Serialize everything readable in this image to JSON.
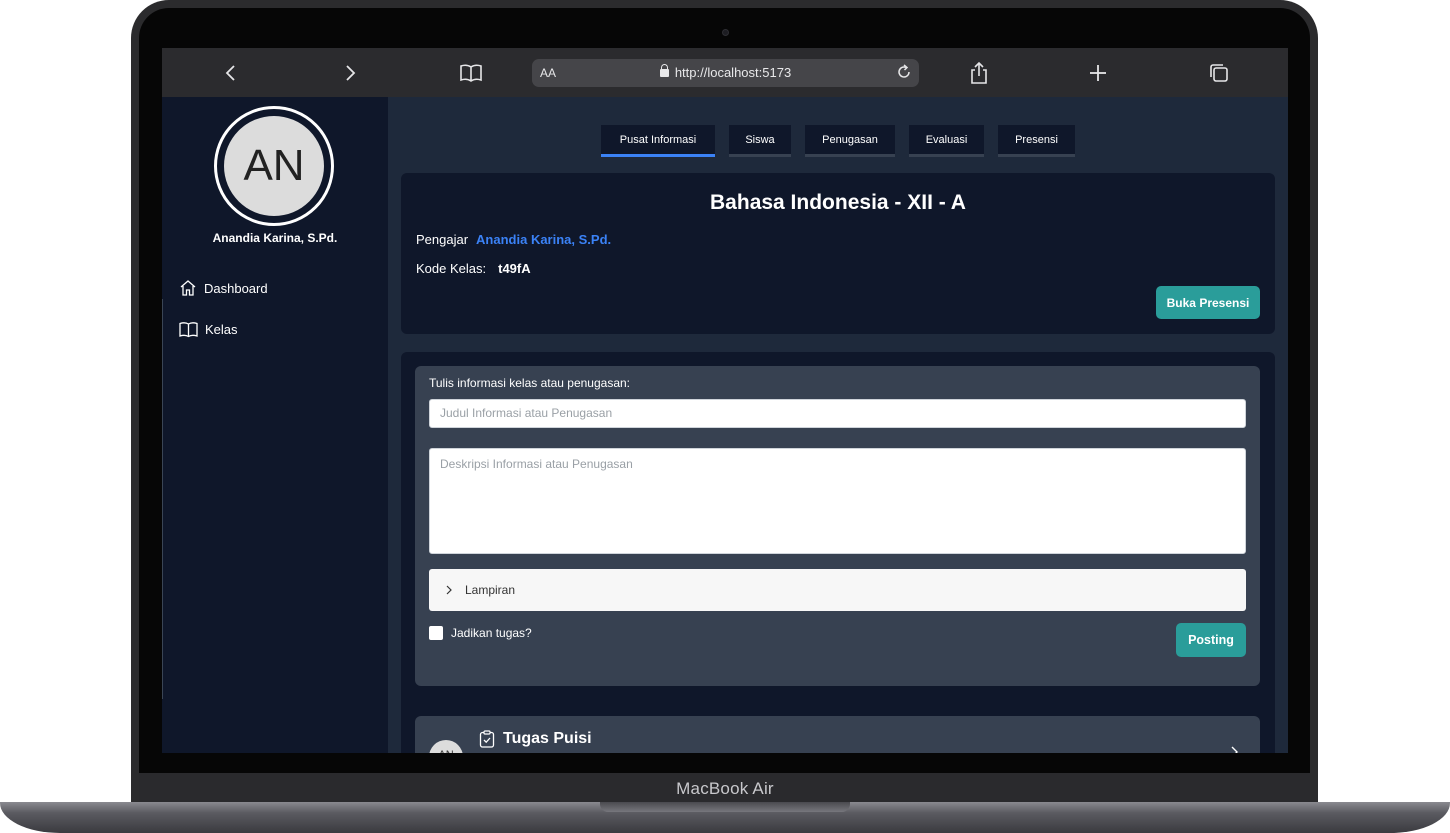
{
  "device": {
    "label": "MacBook Air"
  },
  "browser": {
    "aa_label": "AA",
    "url": "http://localhost:5173",
    "icons": [
      "chevron-left-icon",
      "chevron-right-icon",
      "book-icon",
      "lock-icon",
      "reload-icon",
      "share-icon",
      "plus-icon",
      "tabs-icon"
    ]
  },
  "sidebar": {
    "avatar_initials": "AN",
    "user_name": "Anandia Karina, S.Pd.",
    "items": [
      {
        "label": "Dashboard",
        "icon": "home-icon"
      },
      {
        "label": "Kelas",
        "icon": "book-icon"
      }
    ]
  },
  "tabs": [
    {
      "label": "Pusat Informasi",
      "active": true
    },
    {
      "label": "Siswa",
      "active": false
    },
    {
      "label": "Penugasan",
      "active": false
    },
    {
      "label": "Evaluasi",
      "active": false
    },
    {
      "label": "Presensi",
      "active": false
    }
  ],
  "class_info": {
    "title": "Bahasa Indonesia - XII - A",
    "teacher_label": "Pengajar",
    "teacher_name": "Anandia Karina, S.Pd.",
    "code_label": "Kode Kelas:",
    "code_value": "t49fA",
    "open_attendance_button": "Buka Presensi"
  },
  "post_form": {
    "label": "Tulis informasi kelas atau penugasan:",
    "title_placeholder": "Judul Informasi atau Penugasan",
    "description_placeholder": "Deskripsi Informasi atau Penugasan",
    "attachment_label": "Lampiran",
    "make_task_label": "Jadikan tugas?",
    "post_button": "Posting"
  },
  "feed": [
    {
      "avatar_initials": "AN",
      "title": "Tugas Puisi",
      "icon": "clipboard-check-icon"
    }
  ],
  "colors": {
    "accent_teal": "#2a9d9a",
    "link_blue": "#3b82f6",
    "sidebar_bg": "#0f172a",
    "main_bg": "#1e293b"
  }
}
